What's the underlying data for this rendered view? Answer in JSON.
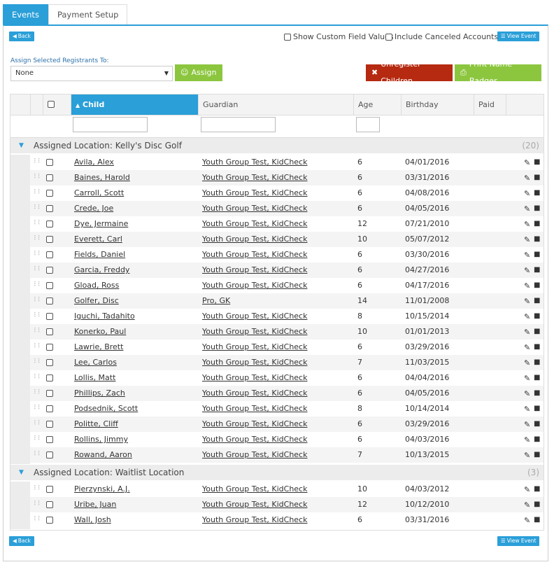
{
  "tabs": [
    "Events",
    "Payment Setup"
  ],
  "toolbar": {
    "back_label": "Back",
    "view_event_label": "View Event",
    "show_custom_fields_label": "Show Custom Field Values",
    "include_canceled_label": "Include Canceled Accounts"
  },
  "assign": {
    "label": "Assign Selected Registrants To:",
    "selected": "None",
    "button_label": "Assign"
  },
  "actions": {
    "unregister_label": "Unregister Children",
    "print_badges_label": "Print Name Badges"
  },
  "colors": {
    "accent": "#2a9fd8",
    "assign_green": "#8cc63f",
    "unregister_red": "#b52a10"
  },
  "table": {
    "columns": [
      "Child",
      "Guardian",
      "Age",
      "Birthday",
      "Paid"
    ],
    "sorted_column": "Child",
    "groups": [
      {
        "title": "Assigned Location: Kelly's Disc Golf",
        "count": "(20)",
        "rows": [
          {
            "child": "Avila, Alex",
            "guardian": "Youth Group Test, KidCheck",
            "age": "6",
            "birthday": "04/01/2016"
          },
          {
            "child": "Baines, Harold",
            "guardian": "Youth Group Test, KidCheck",
            "age": "6",
            "birthday": "03/31/2016"
          },
          {
            "child": "Carroll, Scott",
            "guardian": "Youth Group Test, KidCheck",
            "age": "6",
            "birthday": "04/08/2016"
          },
          {
            "child": "Crede, Joe",
            "guardian": "Youth Group Test, KidCheck",
            "age": "6",
            "birthday": "04/05/2016"
          },
          {
            "child": "Dye, Jermaine",
            "guardian": "Youth Group Test, KidCheck",
            "age": "12",
            "birthday": "07/21/2010"
          },
          {
            "child": "Everett, Carl",
            "guardian": "Youth Group Test, KidCheck",
            "age": "10",
            "birthday": "05/07/2012"
          },
          {
            "child": "Fields, Daniel",
            "guardian": "Youth Group Test, KidCheck",
            "age": "6",
            "birthday": "03/30/2016"
          },
          {
            "child": "Garcia, Freddy",
            "guardian": "Youth Group Test, KidCheck",
            "age": "6",
            "birthday": "04/27/2016"
          },
          {
            "child": "Gload, Ross",
            "guardian": "Youth Group Test, KidCheck",
            "age": "6",
            "birthday": "04/17/2016"
          },
          {
            "child": "Golfer, Disc",
            "guardian": "Pro, GK",
            "age": "14",
            "birthday": "11/01/2008"
          },
          {
            "child": "Iguchi, Tadahito",
            "guardian": "Youth Group Test, KidCheck",
            "age": "8",
            "birthday": "10/15/2014"
          },
          {
            "child": "Konerko, Paul",
            "guardian": "Youth Group Test, KidCheck",
            "age": "10",
            "birthday": "01/01/2013"
          },
          {
            "child": "Lawrie, Brett",
            "guardian": "Youth Group Test, KidCheck",
            "age": "6",
            "birthday": "03/29/2016"
          },
          {
            "child": "Lee, Carlos",
            "guardian": "Youth Group Test, KidCheck",
            "age": "7",
            "birthday": "11/03/2015"
          },
          {
            "child": "Lollis, Matt",
            "guardian": "Youth Group Test, KidCheck",
            "age": "6",
            "birthday": "04/04/2016"
          },
          {
            "child": "Phillips, Zach",
            "guardian": "Youth Group Test, KidCheck",
            "age": "6",
            "birthday": "04/05/2016"
          },
          {
            "child": "Podsednik, Scott",
            "guardian": "Youth Group Test, KidCheck",
            "age": "8",
            "birthday": "10/14/2014"
          },
          {
            "child": "Politte, Cliff",
            "guardian": "Youth Group Test, KidCheck",
            "age": "6",
            "birthday": "03/29/2016"
          },
          {
            "child": "Rollins, Jimmy",
            "guardian": "Youth Group Test, KidCheck",
            "age": "6",
            "birthday": "04/03/2016"
          },
          {
            "child": "Rowand, Aaron",
            "guardian": "Youth Group Test, KidCheck",
            "age": "7",
            "birthday": "10/13/2015"
          }
        ]
      },
      {
        "title": "Assigned Location: Waitlist Location",
        "count": "(3)",
        "rows": [
          {
            "child": "Pierzynski, A.J.",
            "guardian": "Youth Group Test, KidCheck",
            "age": "10",
            "birthday": "04/03/2012"
          },
          {
            "child": "Uribe, Juan",
            "guardian": "Youth Group Test, KidCheck",
            "age": "12",
            "birthday": "10/12/2010"
          },
          {
            "child": "Wall, Josh",
            "guardian": "Youth Group Test, KidCheck",
            "age": "6",
            "birthday": "03/31/2016"
          }
        ]
      }
    ]
  }
}
